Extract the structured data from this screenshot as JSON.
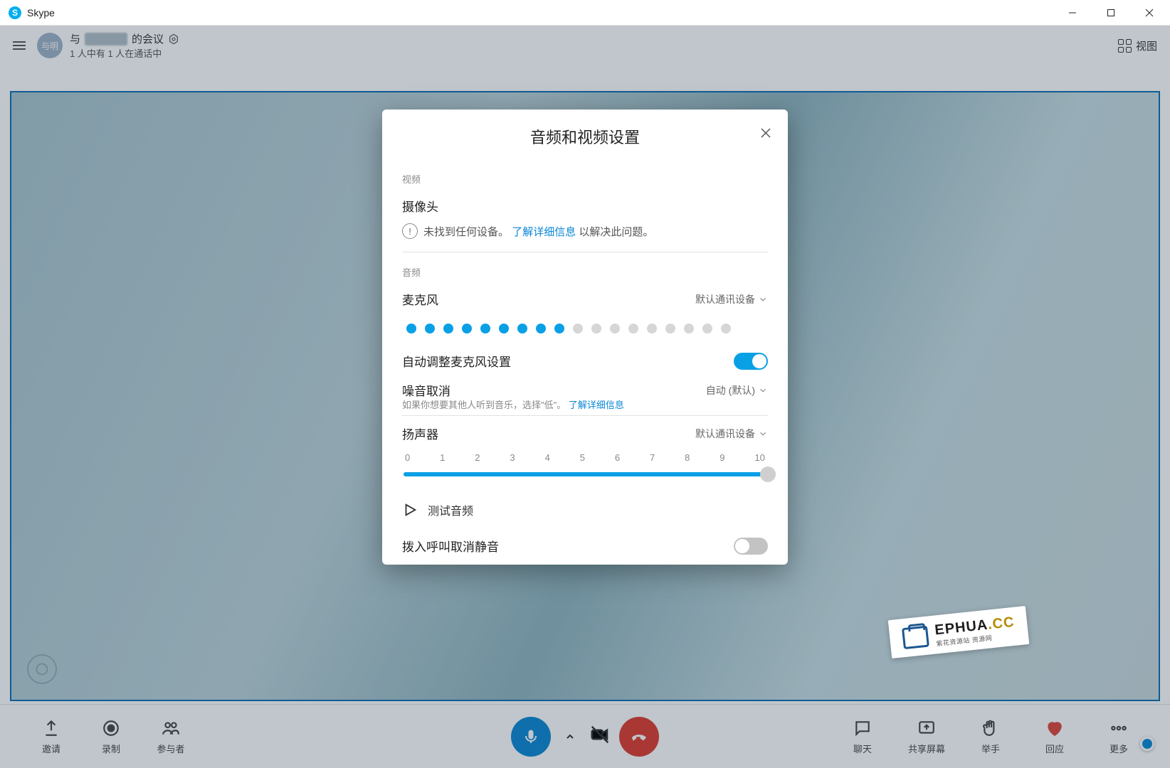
{
  "window": {
    "title": "Skype"
  },
  "header": {
    "avatar_text": "与明",
    "meeting_label_prefix": "与",
    "meeting_label_suffix": "的会议",
    "status_line": "1 人中有 1 人在通话中",
    "view_button": "视图"
  },
  "bottombar": {
    "invite": "邀请",
    "record": "录制",
    "participants": "参与者",
    "chat": "聊天",
    "share_screen": "共享屏幕",
    "raise_hand": "举手",
    "reaction": "回应",
    "more": "更多"
  },
  "modal": {
    "title": "音频和视频设置",
    "video_section": "视频",
    "camera_label": "摄像头",
    "camera_warning_pre": "未找到任何设备。",
    "camera_warning_link": "了解详细信息",
    "camera_warning_post": "以解决此问题。",
    "audio_section": "音频",
    "mic_label": "麦克风",
    "mic_device": "默认通讯设备",
    "mic_level_active_dots": 9,
    "mic_level_total_dots": 18,
    "auto_adjust_label": "自动调整麦克风设置",
    "auto_adjust_on": true,
    "noise_label": "噪音取消",
    "noise_value": "自动 (默认)",
    "noise_desc_pre": "如果你想要其他人听到音乐，选择\"低\"。",
    "noise_desc_link": "了解详细信息",
    "speaker_label": "扬声器",
    "speaker_device": "默认通讯设备",
    "speaker_ticks": [
      "0",
      "1",
      "2",
      "3",
      "4",
      "5",
      "6",
      "7",
      "8",
      "9",
      "10"
    ],
    "speaker_value": 10,
    "speaker_max": 10,
    "test_audio": "测试音频",
    "unmute_incoming_label": "拨入呼叫取消静音",
    "unmute_incoming_on": false
  },
  "watermark": {
    "brand": "EPHUA",
    "tld": ".CC",
    "sub": "紫花资源站 资源网"
  }
}
